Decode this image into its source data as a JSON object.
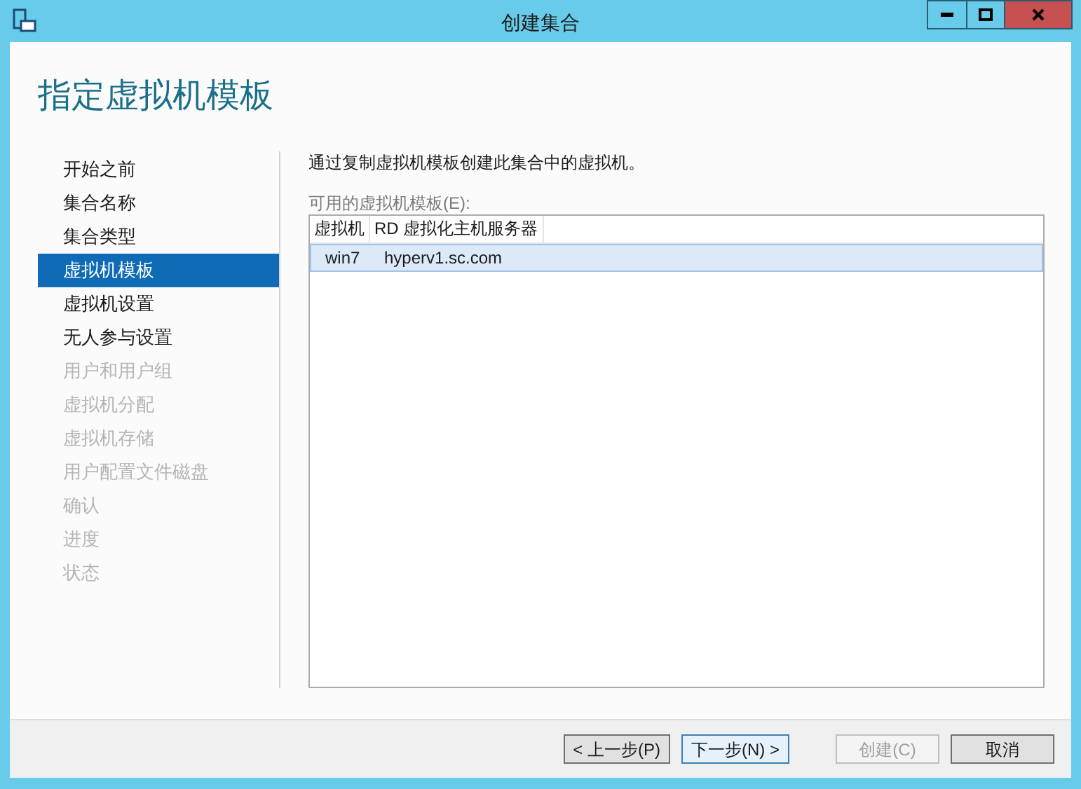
{
  "window": {
    "title": "创建集合"
  },
  "page_title": "指定虚拟机模板",
  "steps": [
    {
      "label": "开始之前",
      "selected": false,
      "disabled": false
    },
    {
      "label": "集合名称",
      "selected": false,
      "disabled": false
    },
    {
      "label": "集合类型",
      "selected": false,
      "disabled": false
    },
    {
      "label": "虚拟机模板",
      "selected": true,
      "disabled": false
    },
    {
      "label": "虚拟机设置",
      "selected": false,
      "disabled": false
    },
    {
      "label": "无人参与设置",
      "selected": false,
      "disabled": false
    },
    {
      "label": "用户和用户组",
      "selected": false,
      "disabled": true
    },
    {
      "label": "虚拟机分配",
      "selected": false,
      "disabled": true
    },
    {
      "label": "虚拟机存储",
      "selected": false,
      "disabled": true
    },
    {
      "label": "用户配置文件磁盘",
      "selected": false,
      "disabled": true
    },
    {
      "label": "确认",
      "selected": false,
      "disabled": true
    },
    {
      "label": "进度",
      "selected": false,
      "disabled": true
    },
    {
      "label": "状态",
      "selected": false,
      "disabled": true
    }
  ],
  "description": "通过复制虚拟机模板创建此集合中的虚拟机。",
  "table": {
    "label": "可用的虚拟机模板(E):",
    "columns": [
      "虚拟机",
      "RD 虚拟化主机服务器"
    ],
    "rows": [
      {
        "cells": [
          "win7",
          "hyperv1.sc.com"
        ],
        "selected": true
      }
    ]
  },
  "buttons": [
    {
      "label": "< 上一步(P)",
      "disabled": false,
      "default": false
    },
    {
      "label": "下一步(N) >",
      "disabled": false,
      "default": true
    },
    {
      "label": "创建(C)",
      "disabled": true,
      "default": false
    },
    {
      "label": "取消",
      "disabled": false,
      "default": false
    }
  ]
}
